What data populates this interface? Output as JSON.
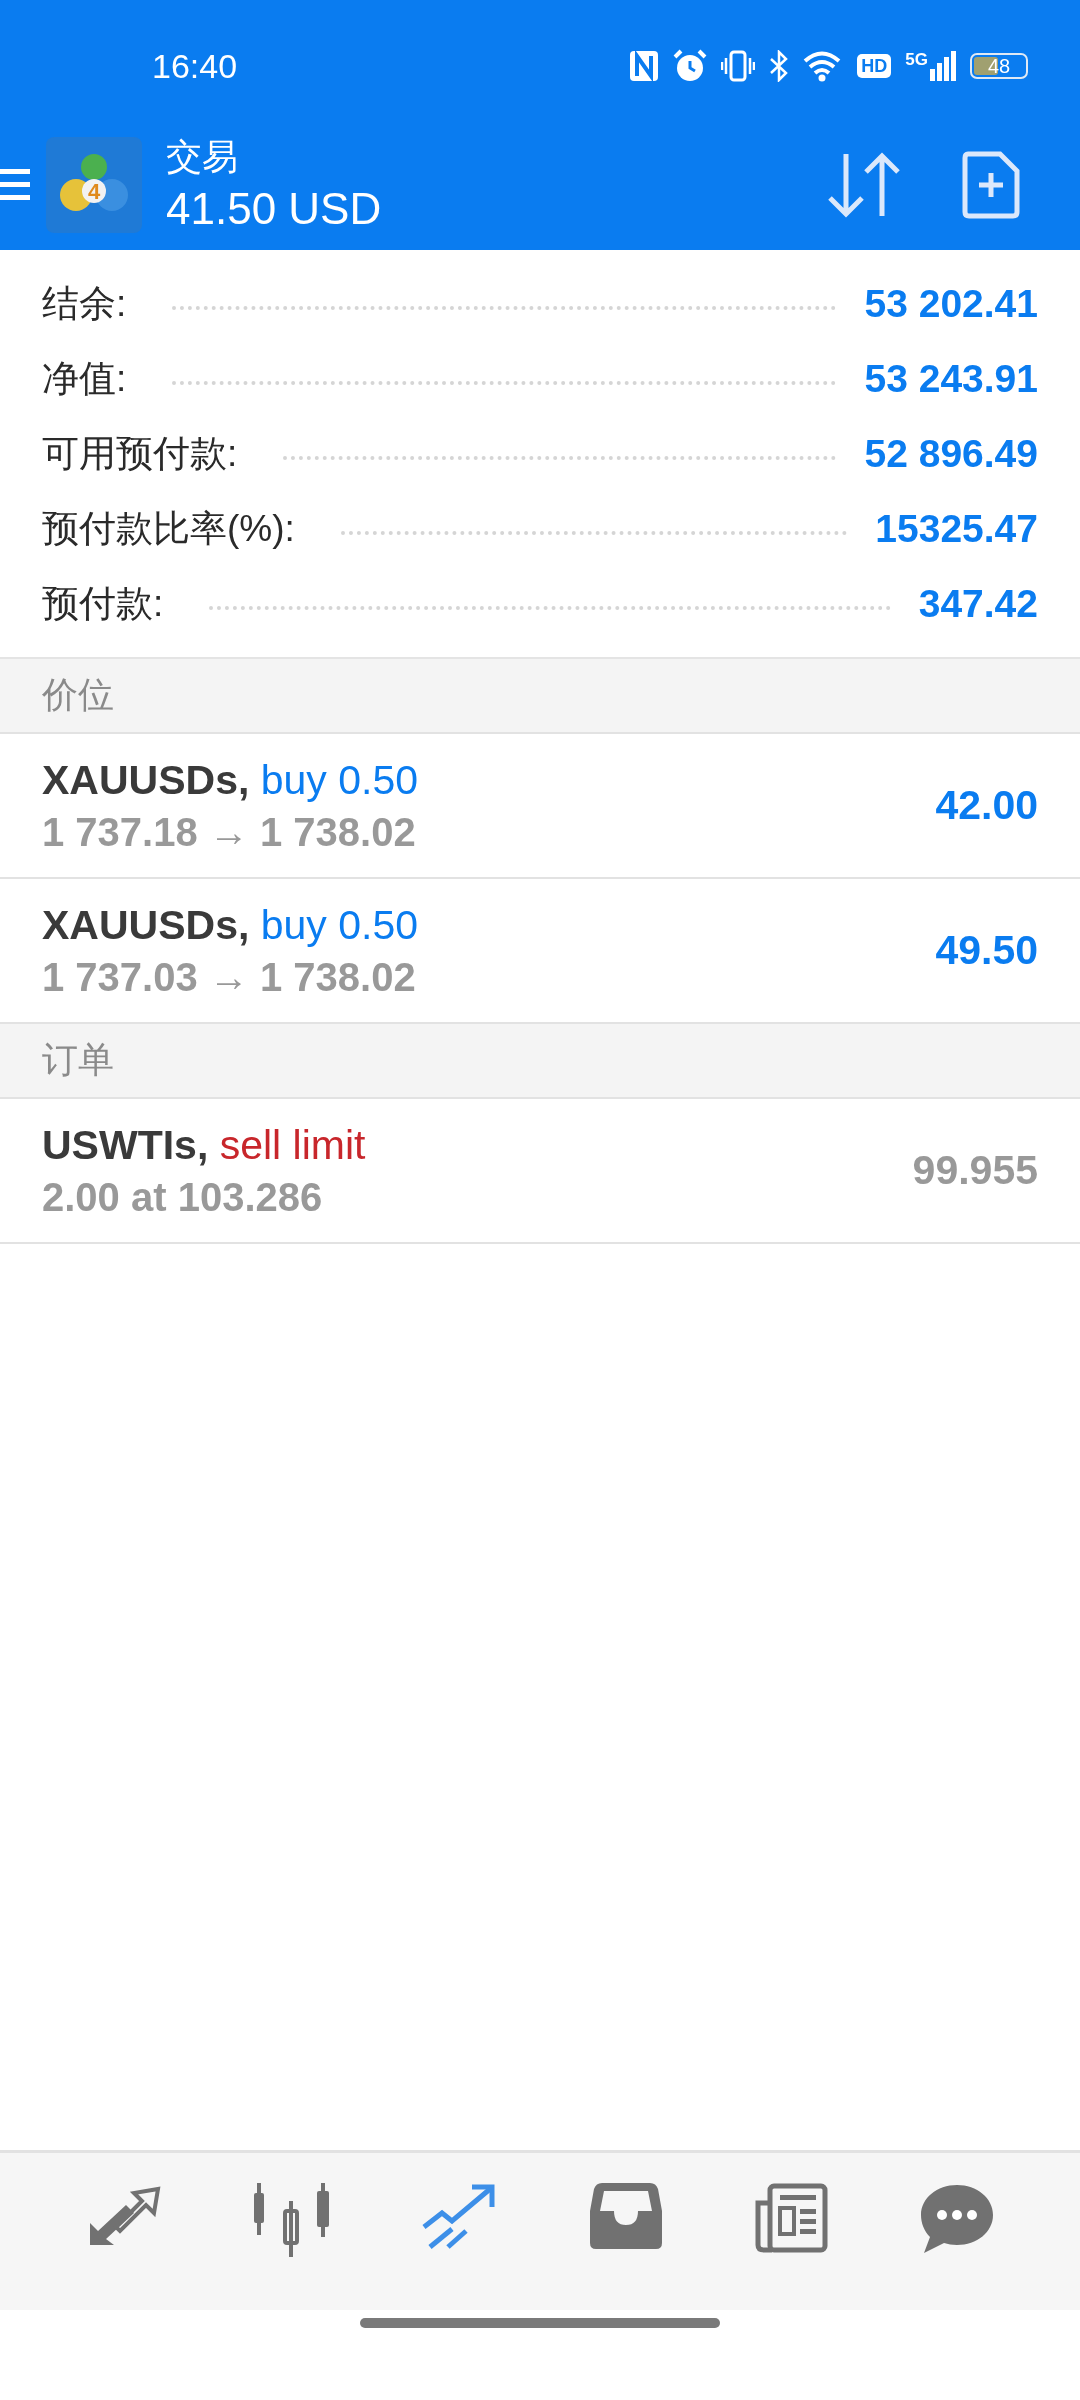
{
  "status_bar": {
    "time": "16:40",
    "hd": "HD",
    "network": "5G",
    "battery": "48"
  },
  "header": {
    "logo_badge": "4",
    "title": "交易",
    "subtitle": "41.50 USD"
  },
  "summary": [
    {
      "label": "结余:",
      "value": "53 202.41"
    },
    {
      "label": "净值:",
      "value": "53 243.91"
    },
    {
      "label": "可用预付款:",
      "value": "52 896.49"
    },
    {
      "label": "预付款比率(%):",
      "value": "15325.47"
    },
    {
      "label": "预付款:",
      "value": "347.42"
    }
  ],
  "sections": [
    {
      "title": "价位",
      "kind": "positions",
      "items": [
        {
          "symbol": "XAUUSDs,",
          "action": "buy 0.50",
          "kind": "buy",
          "detail": "1 737.18 → 1 738.02",
          "value": "42.00"
        },
        {
          "symbol": "XAUUSDs,",
          "action": "buy 0.50",
          "kind": "buy",
          "detail": "1 737.03 → 1 738.02",
          "value": "49.50"
        }
      ]
    },
    {
      "title": "订单",
      "kind": "orders",
      "items": [
        {
          "symbol": "USWTIs,",
          "action": "sell limit",
          "kind": "sell",
          "detail": "2.00 at 103.286",
          "value": "99.955"
        }
      ]
    }
  ],
  "nav": [
    {
      "kind": "quotes",
      "selected": false
    },
    {
      "kind": "chart",
      "selected": false
    },
    {
      "kind": "trade",
      "selected": true
    },
    {
      "kind": "history",
      "selected": false
    },
    {
      "kind": "news",
      "selected": false
    },
    {
      "kind": "chat",
      "selected": false
    }
  ]
}
